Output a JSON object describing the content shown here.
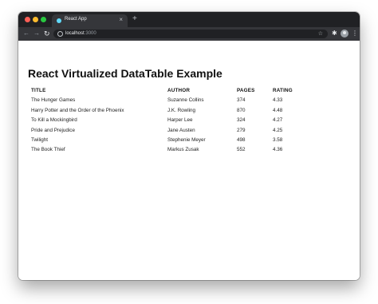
{
  "browser": {
    "tab_title": "React App",
    "tab_close": "×",
    "new_tab": "+",
    "url_host": "localhost",
    "url_port": ":3000",
    "colors": {
      "titlebar": "#202124",
      "toolbar": "#35363a",
      "favicon": "#61dafb"
    }
  },
  "page": {
    "title": "React Virtualized DataTable Example"
  },
  "table": {
    "headers": {
      "title": "TITLE",
      "author": "AUTHOR",
      "pages": "PAGES",
      "rating": "RATING"
    },
    "rows": [
      {
        "title": "The Hunger Games",
        "author": "Suzanne Collins",
        "pages": "374",
        "rating": "4.33"
      },
      {
        "title": "Harry Potter and the Order of the Phoenix",
        "author": "J.K. Rowling",
        "pages": "870",
        "rating": "4.48"
      },
      {
        "title": "To Kill a Mockingbird",
        "author": "Harper Lee",
        "pages": "324",
        "rating": "4.27"
      },
      {
        "title": "Pride and Prejudice",
        "author": "Jane Austen",
        "pages": "279",
        "rating": "4.25"
      },
      {
        "title": "Twilight",
        "author": "Stephenie Meyer",
        "pages": "498",
        "rating": "3.58"
      },
      {
        "title": "The Book Thief",
        "author": "Markus Zusak",
        "pages": "552",
        "rating": "4.36"
      }
    ]
  },
  "icons": [
    "close-window-icon",
    "minimize-icon",
    "zoom-icon",
    "react-favicon-icon",
    "back-icon",
    "forward-icon",
    "reload-icon",
    "info-icon",
    "star-icon",
    "extensions-icon",
    "avatar",
    "menu-icon"
  ]
}
